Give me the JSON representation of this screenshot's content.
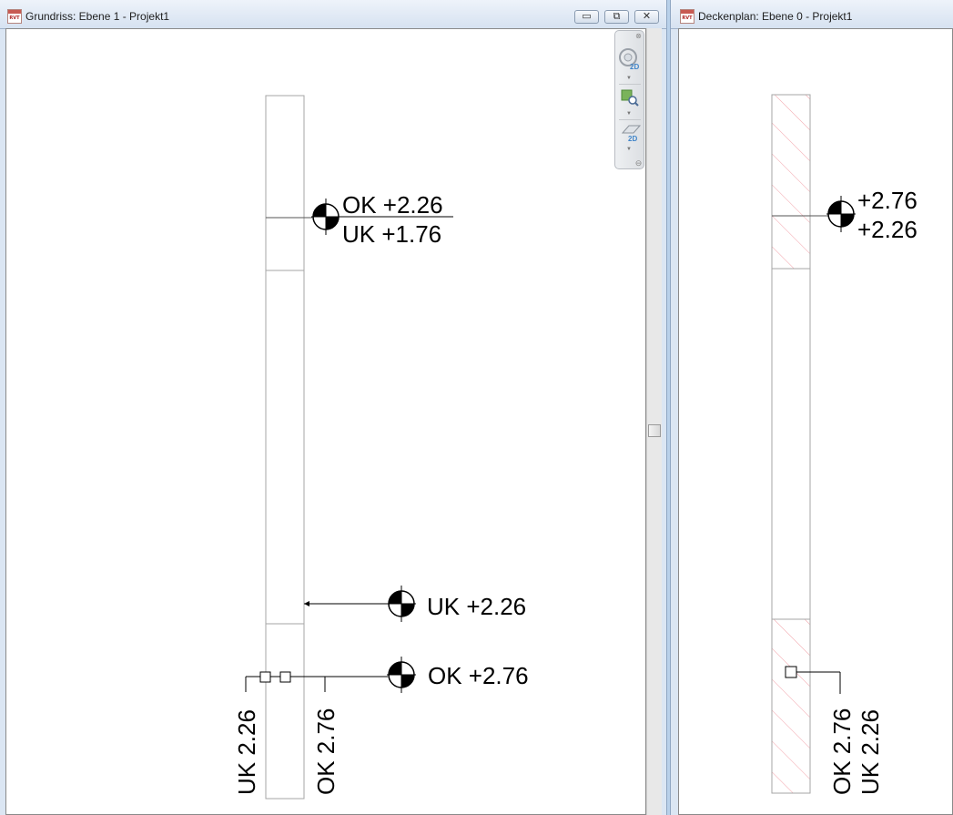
{
  "left_window": {
    "title": "Grundriss: Ebene 1 - Projekt1",
    "icon_text": "RVT",
    "controls": {
      "minimize": "▭",
      "restore": "⧉",
      "close": "✕"
    },
    "tags": {
      "top_ok": "OK +2.26",
      "top_uk": "UK +1.76",
      "mid_uk": "UK +2.26",
      "bottom_ok": "OK +2.76",
      "vert_uk": "UK 2.26",
      "vert_ok": "OK 2.76"
    }
  },
  "right_window": {
    "title": "Deckenplan: Ebene 0 - Projekt1",
    "icon_text": "RVT",
    "tags": {
      "top_upper": "+2.76",
      "top_lower": "+2.26",
      "vert_ok": "OK 2.76",
      "vert_uk": "UK 2.26"
    }
  },
  "navigation_bar": {
    "steering_wheel_badge": "2D",
    "zoom_icon": "zoom-region-icon",
    "pan_badge": "2D"
  },
  "colors": {
    "hatch": "#f2a0a8",
    "line": "#000000",
    "element_outline": "#a6a6a6"
  }
}
